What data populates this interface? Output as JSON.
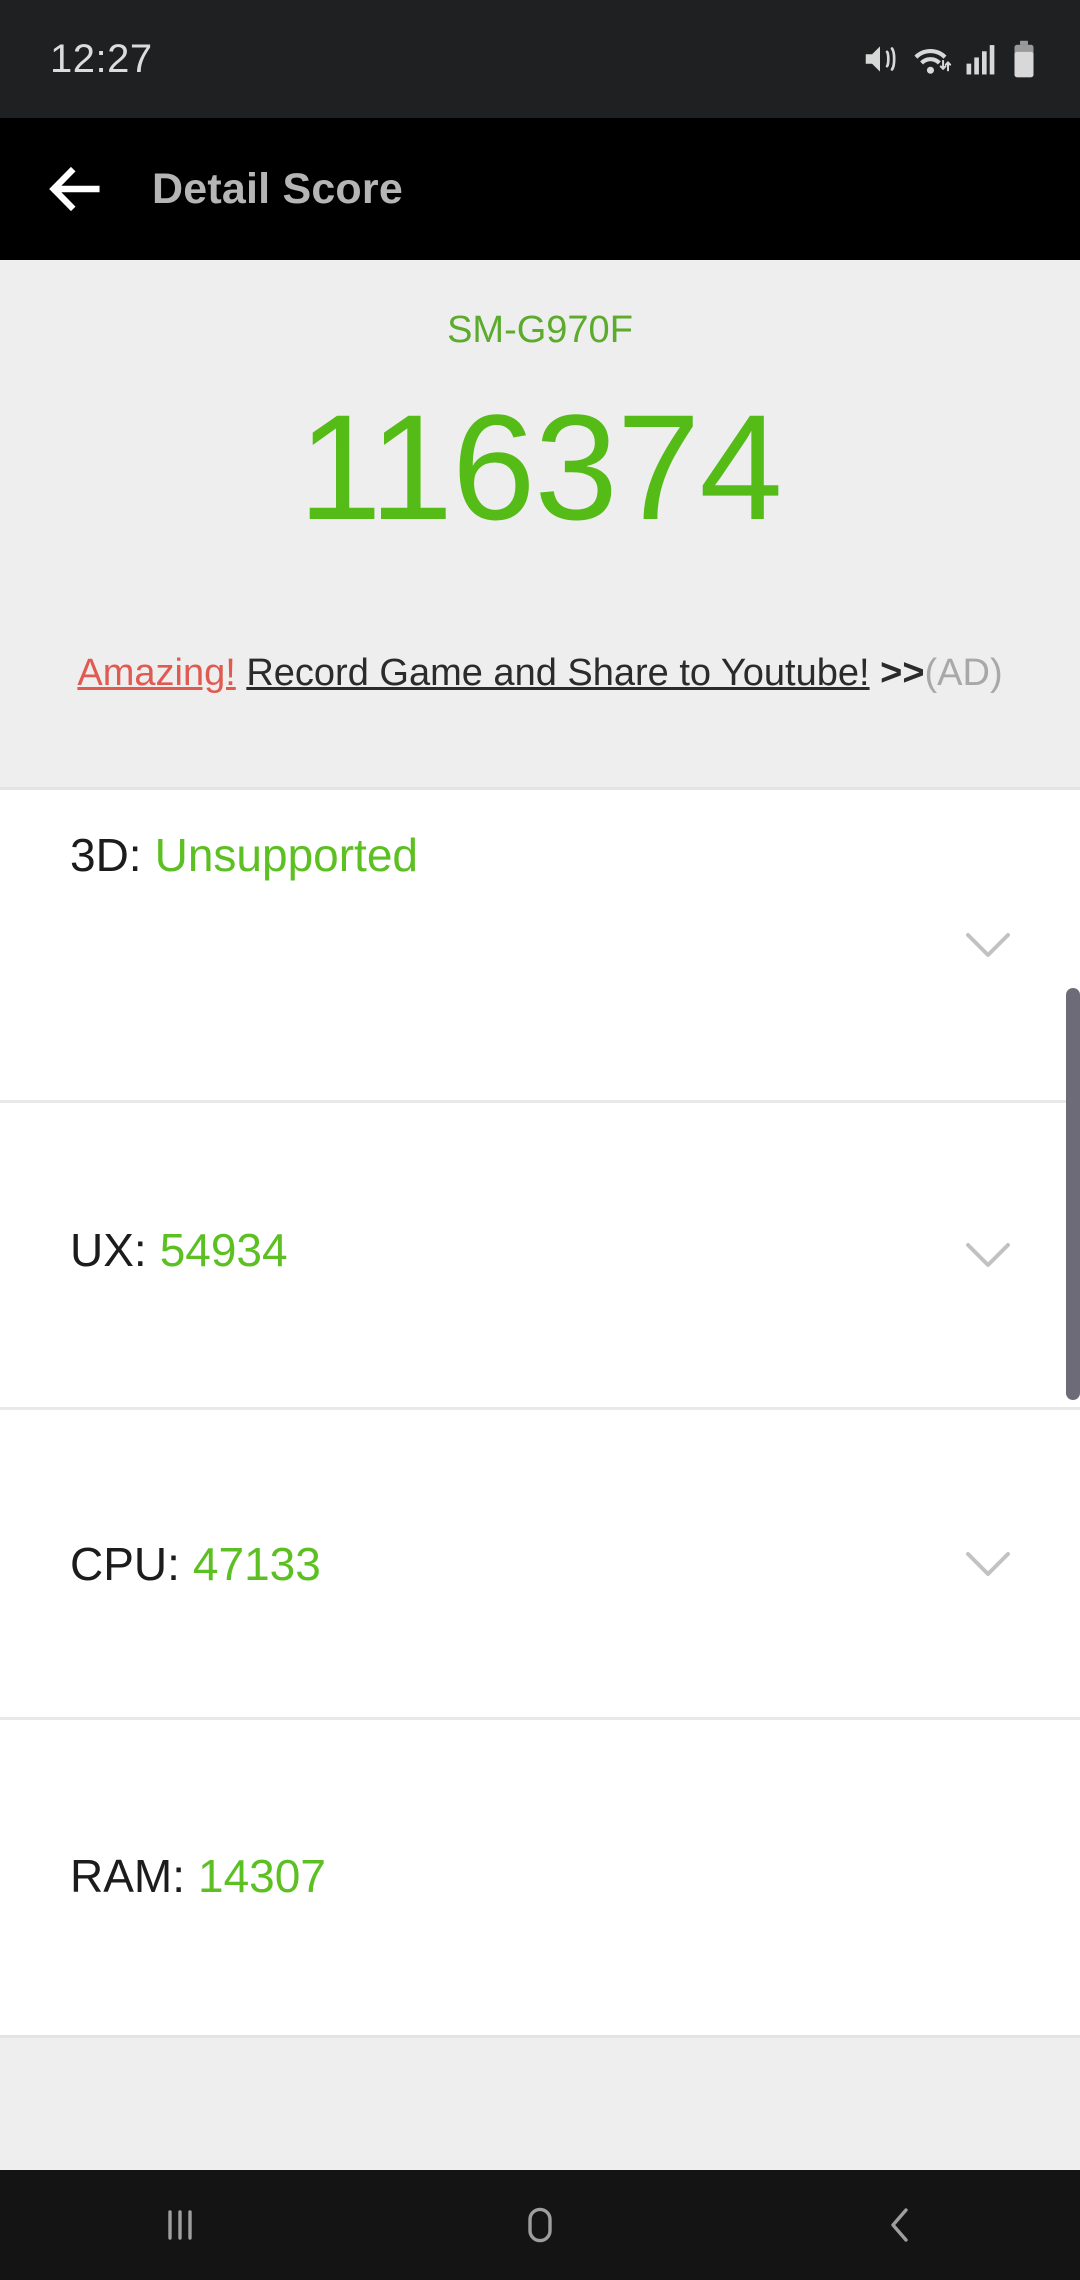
{
  "status_bar": {
    "time": "12:27",
    "icons": [
      "mute-icon",
      "wifi-icon",
      "signal-icon",
      "battery-icon"
    ]
  },
  "app_bar": {
    "back_icon": "back-arrow-icon",
    "title": "Detail Score"
  },
  "summary": {
    "device_model": "SM-G970F",
    "total_score": "116374",
    "ad": {
      "hook": "Amazing!",
      "text": "Record Game and Share to Youtube!",
      "arrows": ">>",
      "tag": "(AD)"
    }
  },
  "list": {
    "rows": [
      {
        "label": "3D:",
        "value": "Unsupported",
        "has_chevron": true
      },
      {
        "label": "UX:",
        "value": "54934",
        "has_chevron": true
      },
      {
        "label": "CPU:",
        "value": "47133",
        "has_chevron": true
      },
      {
        "label": "RAM:",
        "value": "14307",
        "has_chevron": false
      }
    ]
  },
  "nav_bar": {
    "recents_label": "recents-icon",
    "home_label": "home-icon",
    "back_label": "back-icon"
  },
  "colors": {
    "score_green": "#55bb16",
    "model_green": "#5cab2d",
    "value_green": "#5cc022",
    "ad_red": "#e05a52",
    "panel_gray": "#eeeeee",
    "scrollbar": "#6e6b78"
  }
}
